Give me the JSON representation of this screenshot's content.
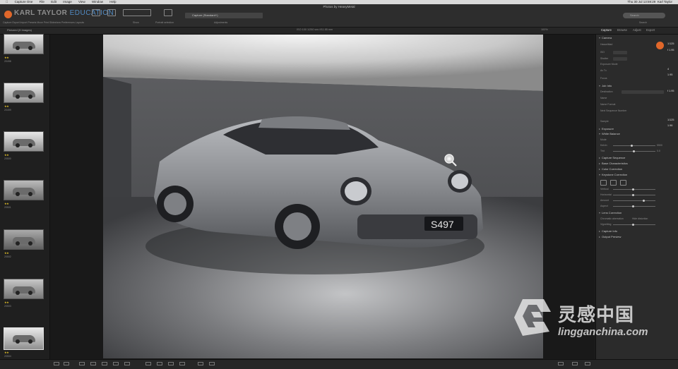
{
  "menubar": {
    "items": [
      "Capture One",
      "File",
      "Edit",
      "Image",
      "View",
      "Window",
      "Help"
    ],
    "clock": "Thu 30 Jul 13:59:29",
    "user": "Karl Taylor"
  },
  "window_title": "Photos by HeavyMetal",
  "overlay_name": {
    "part1": "KARL TAYLOR",
    "part2": "EDUCATION"
  },
  "toolbar": {
    "left_labels": [
      "Capture",
      "Export",
      "Import",
      "Presets",
      "Move",
      "Print",
      "Slideshow",
      "Preferences"
    ],
    "layouts_label": "Layouts",
    "show_label": "Show",
    "portrait_label": "Portrait selection",
    "adjustments_label": "Adjustments",
    "style_value": "Capture (Standard+)",
    "search_label": "Search",
    "search_placeholder": "Search"
  },
  "browser": {
    "title": "Pictured (9 Images)",
    "thumbnails": [
      {
        "name": "20498",
        "stars": "★★"
      },
      {
        "name": "20499",
        "stars": "★★"
      },
      {
        "name": "20500",
        "stars": "★★"
      },
      {
        "name": "20501",
        "stars": "★★"
      },
      {
        "name": "20502",
        "stars": "★★"
      },
      {
        "name": "20503",
        "stars": "★★"
      },
      {
        "name": "20504",
        "stars": "★★"
      }
    ]
  },
  "viewer": {
    "info": "ISO 100   1/250 sec   f/11   85 mm",
    "zoom": "100%",
    "license_plate": "S497"
  },
  "right_tabs": [
    "Capture",
    "Browse",
    "Adjust",
    "Export"
  ],
  "capture_panel": {
    "camera_section": "Camera",
    "camera_rows": [
      "Hasselblad",
      "ISO",
      "Shutter",
      "Exposure Mode",
      "Av Tv",
      "Focus"
    ],
    "next_capture_section": "Job Info",
    "next_rows": [
      "Destination",
      "Name",
      "Name Format",
      "Next Sequence Number",
      "Sample"
    ],
    "exposure_section": "Exposure",
    "white_balance_section": "White Balance",
    "wb_rows": [
      "Mode",
      "Kelvin",
      "Tint"
    ],
    "wb_values": [
      "5500",
      "0.0"
    ],
    "sections_more": [
      "Capture Sequence",
      "Base Characteristics",
      "Color Correction",
      "Keystone Correction"
    ],
    "keystone_rows": [
      "Vertical",
      "Horizontal",
      "Amount",
      "Aspect"
    ],
    "lens_section": "Lens Correction",
    "lens_rows": [
      "Chromatic aberration",
      "Hide distortion",
      "Vignetting"
    ],
    "tail_sections": [
      "Capture Info",
      "Output Preview"
    ],
    "side_numbers": [
      "1/125",
      "f 1.95",
      "4",
      "1.95",
      "f 1.95",
      "1/125",
      "1.96"
    ]
  },
  "logo": {
    "chinese": "灵感中国",
    "url": "lingganchina.com"
  }
}
